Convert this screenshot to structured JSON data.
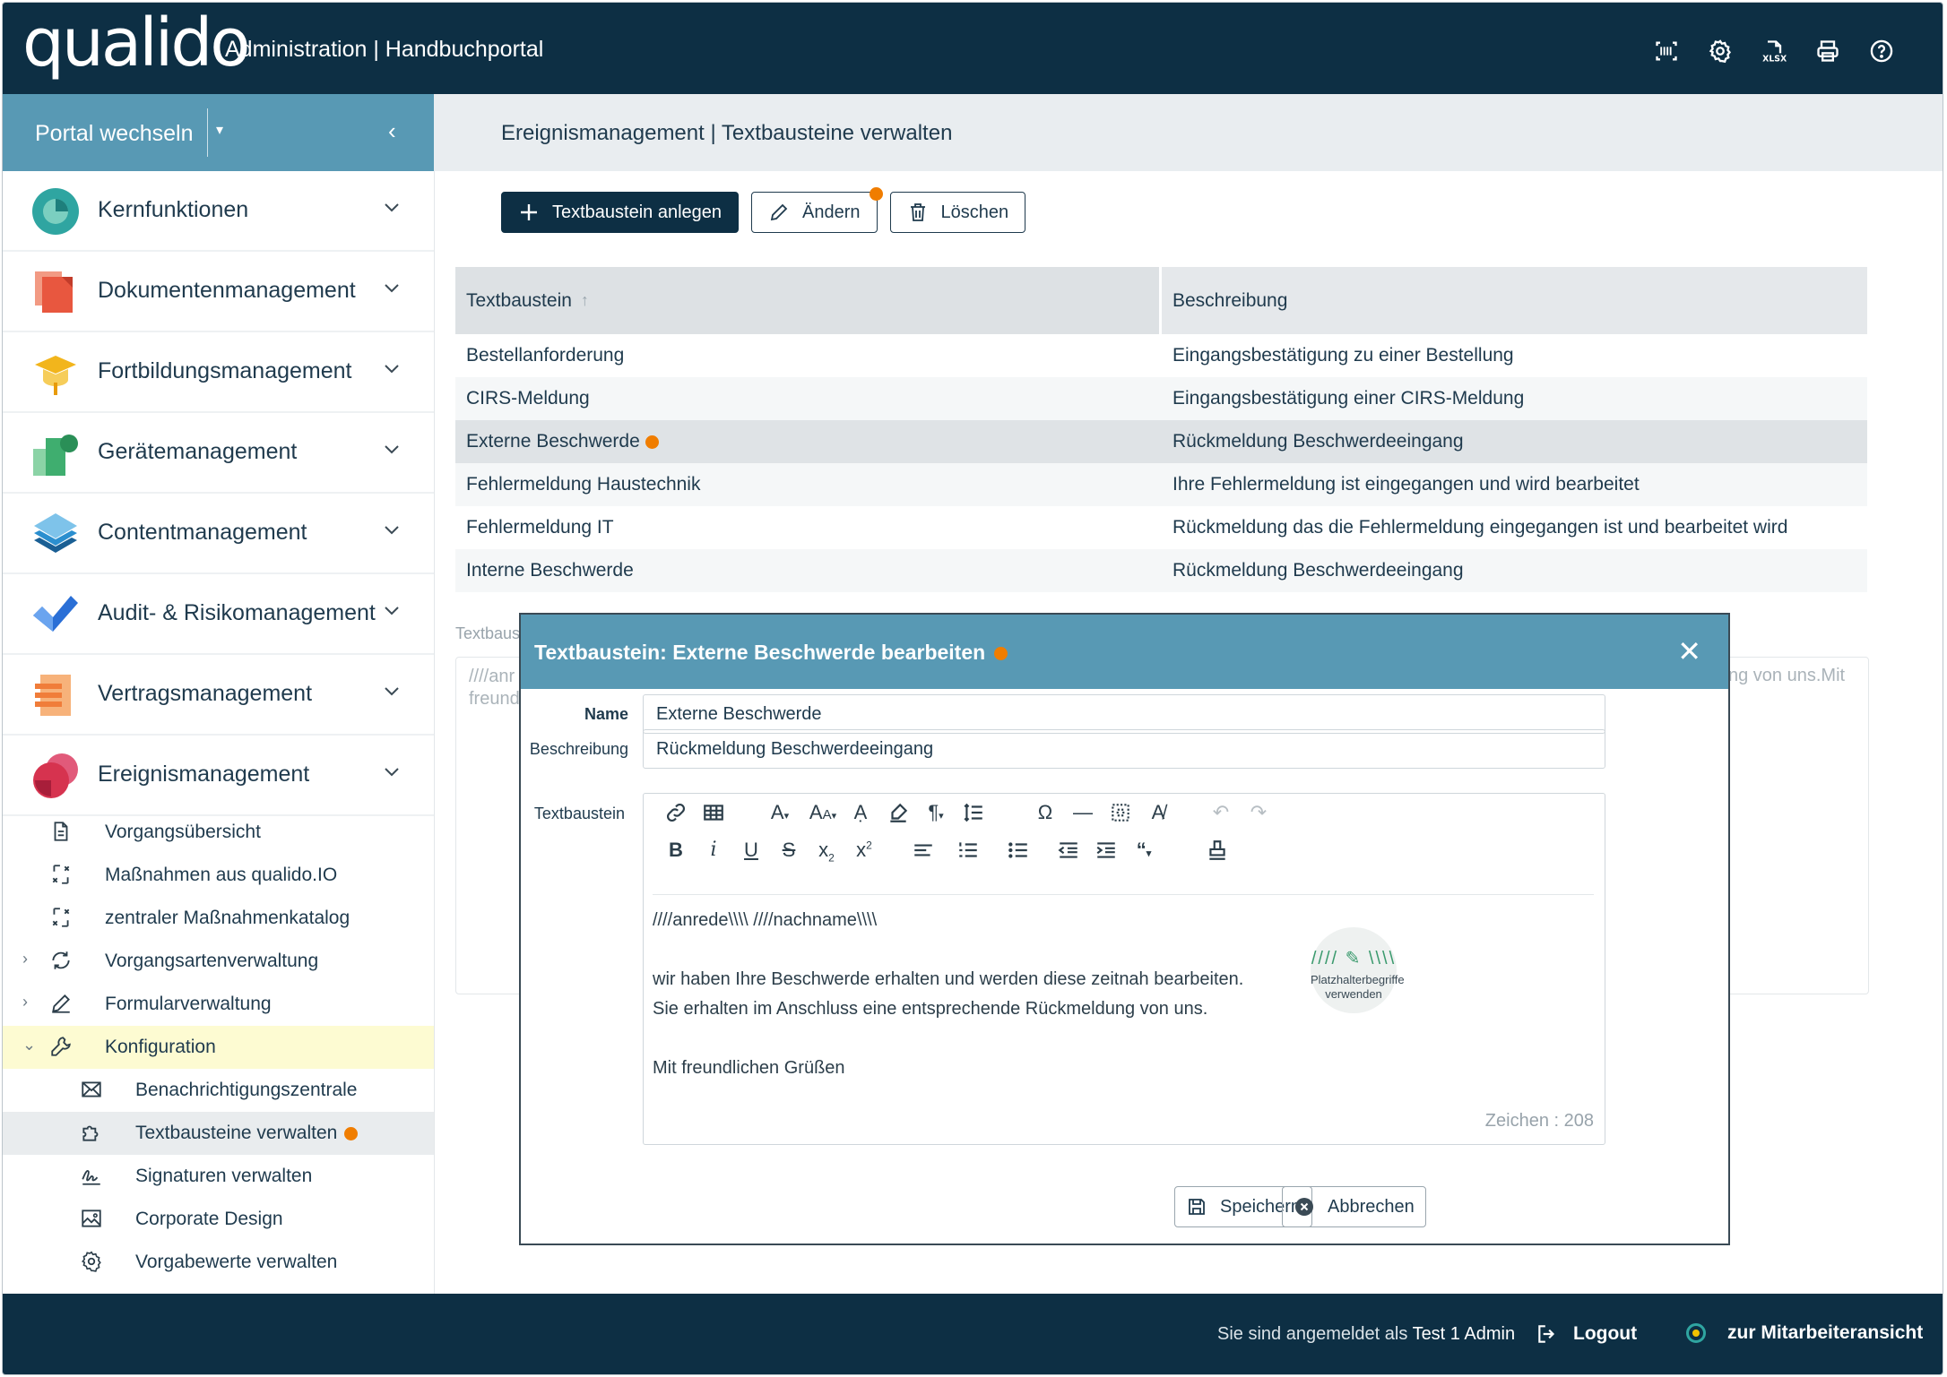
{
  "header": {
    "logo": "qualido",
    "app_title": "Administration | Handbuchportal",
    "icons": [
      "barcode-icon",
      "gear-icon",
      "xlsx-icon",
      "print-icon",
      "help-icon"
    ]
  },
  "sidebar": {
    "portal_switch_label": "Portal wechseln",
    "modules": [
      {
        "label": "Kernfunktionen",
        "icon": "kernfunktionen-icon",
        "color": "#2fa5a1"
      },
      {
        "label": "Dokumentenmanagement",
        "icon": "document-stack-icon",
        "color": "#e8573f"
      },
      {
        "label": "Fortbildungsmanagement",
        "icon": "graduation-cap-icon",
        "color": "#f2b51c"
      },
      {
        "label": "Gerätemanagement",
        "icon": "devices-icon",
        "color": "#3fae6f"
      },
      {
        "label": "Contentmanagement",
        "icon": "layers-icon",
        "color": "#2b8fcf"
      },
      {
        "label": "Audit- & Risikomanagement",
        "icon": "checkmark-icon",
        "color": "#2a6fd6"
      },
      {
        "label": "Vertragsmanagement",
        "icon": "contract-icon",
        "color": "#f07d3a"
      },
      {
        "label": "Ereignismanagement",
        "icon": "event-icon",
        "color": "#d6334f"
      }
    ],
    "subitems": [
      {
        "label": "Vorgangsübersicht",
        "icon": "document-icon"
      },
      {
        "label": "Maßnahmen aus qualido.IO",
        "icon": "measures-icon"
      },
      {
        "label": "zentraler Maßnahmenkatalog",
        "icon": "catalog-icon"
      },
      {
        "label": "Vorgangsartenverwaltung",
        "icon": "refresh-icon"
      },
      {
        "label": "Formularverwaltung",
        "icon": "pencil-icon"
      },
      {
        "label": "Konfiguration",
        "icon": "wrench-icon"
      },
      {
        "label": "Benachrichtigungszentrale",
        "icon": "mail-icon"
      },
      {
        "label": "Textbausteine verwalten",
        "icon": "puzzle-icon"
      },
      {
        "label": "Signaturen verwalten",
        "icon": "signature-icon"
      },
      {
        "label": "Corporate Design",
        "icon": "image-icon"
      },
      {
        "label": "Vorgabewerte verwalten",
        "icon": "gear-icon"
      }
    ]
  },
  "main": {
    "breadcrumb": "Ereignismanagement | Textbausteine verwalten",
    "toolbar": {
      "create_label": "Textbaustein anlegen",
      "edit_label": "Ändern",
      "delete_label": "Löschen"
    },
    "table": {
      "columns": [
        "Textbaustein",
        "Beschreibung"
      ],
      "rows": [
        {
          "name": "Bestellanforderung",
          "desc": "Eingangsbestätigung zu einer Bestellung"
        },
        {
          "name": "CIRS-Meldung",
          "desc": "Eingangsbestätigung einer CIRS-Meldung"
        },
        {
          "name": "Externe Beschwerde",
          "desc": "Rückmeldung Beschwerdeeingang"
        },
        {
          "name": "Fehlermeldung Haustechnik",
          "desc": "Ihre Fehlermeldung ist eingegangen und wird bearbeitet"
        },
        {
          "name": "Fehlermeldung IT",
          "desc": "Rückmeldung das die Fehlermeldung eingegangen ist und bearbeitet wird"
        },
        {
          "name": "Interne Beschwerde",
          "desc": "Rückmeldung Beschwerdeeingang"
        }
      ]
    },
    "background_editor": {
      "label": "Textbaus",
      "text_left_1": "////anr",
      "text_left_2": "freund",
      "text_right": "ng von uns.Mit"
    }
  },
  "modal": {
    "title": "Textbaustein: Externe Beschwerde bearbeiten",
    "name_label": "Name",
    "name_value": "Externe Beschwerde",
    "desc_label": "Beschreibung",
    "desc_value": "Rückmeldung Beschwerdeeingang",
    "text_label": "Textbaustein",
    "editor_lines": [
      "////anrede\\\\\\\\ ////nachname\\\\\\\\",
      "",
      "wir haben Ihre Beschwerde erhalten und werden diese zeitnah bearbeiten.",
      "Sie erhalten im Anschluss eine entsprechende Rückmeldung von uns.",
      "",
      "Mit freundlichen Grüßen"
    ],
    "placeholder_button": "Platzhalterbegriffe verwenden",
    "char_count": "Zeichen : 208",
    "save_label": "Speichern",
    "cancel_label": "Abbrechen"
  },
  "footer": {
    "logged_in_prefix": "Sie sind angemeldet als",
    "user": "Test 1 Admin",
    "logout_label": "Logout",
    "employee_view_label": "zur Mitarbeiteransicht"
  },
  "colors": {
    "navy": "#0d2f44",
    "teal_blue": "#5899b4",
    "orange_dot": "#f07d00",
    "highlight_yellow": "#fdfbd2"
  }
}
